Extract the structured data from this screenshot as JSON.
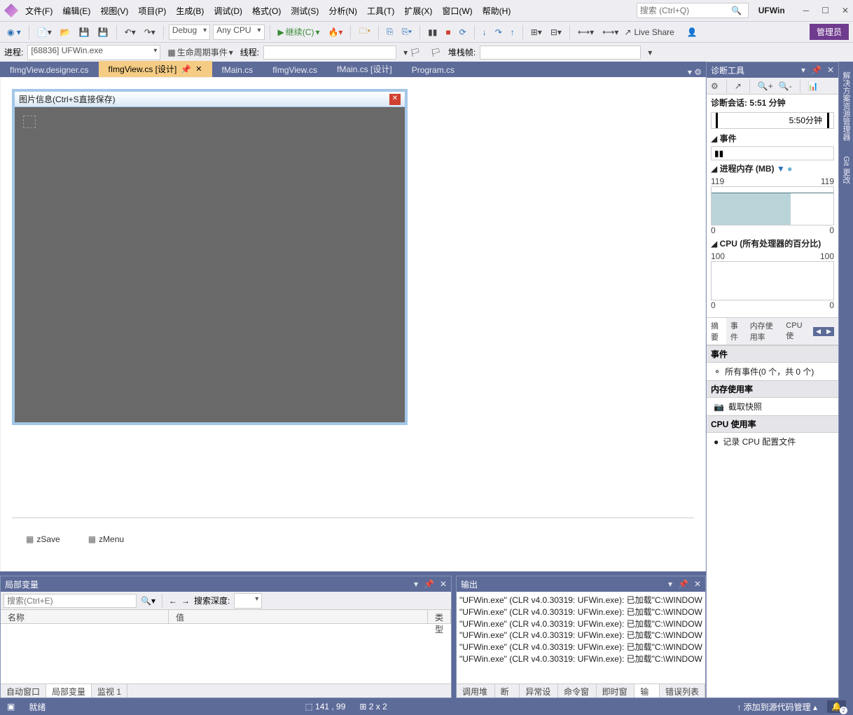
{
  "menu": {
    "file": "文件(F)",
    "edit": "编辑(E)",
    "view": "视图(V)",
    "project": "项目(P)",
    "build": "生成(B)",
    "debug": "调试(D)",
    "format": "格式(O)",
    "test": "测试(S)",
    "analyze": "分析(N)",
    "tools": "工具(T)",
    "extensions": "扩展(X)",
    "window": "窗口(W)",
    "help": "帮助(H)"
  },
  "search": {
    "placeholder": "搜索 (Ctrl+Q)"
  },
  "project_name": "UFWin",
  "toolbar": {
    "config": "Debug",
    "platform": "Any CPU",
    "start": "继续(C)",
    "liveshare": "Live Share",
    "admin": "管理员"
  },
  "toolbar2": {
    "process_lbl": "进程:",
    "process_val": "[68836] UFWin.exe",
    "lifecycle": "生命周期事件",
    "thread": "线程:",
    "stackframe": "堆栈帧:"
  },
  "tabs": {
    "t1": "fImgView.designer.cs",
    "t2": "fImgView.cs [设计]",
    "t3": "fMain.cs",
    "t4": "fImgView.cs",
    "t5": "fMain.cs [设计]",
    "t6": "Program.cs"
  },
  "form": {
    "title": "图片信息(Ctrl+S直接保存)"
  },
  "tray": {
    "i1": "zSave",
    "i2": "zMenu"
  },
  "locals": {
    "title": "局部变量",
    "search_ph": "搜索(Ctrl+E)",
    "depth": "搜索深度:",
    "col1": "名称",
    "col2": "值",
    "col3": "类型",
    "tab1": "自动窗口",
    "tab2": "局部变量",
    "tab3": "监视 1"
  },
  "output": {
    "title": "输出",
    "tab1": "调用堆栈",
    "tab2": "断点",
    "tab3": "异常设置",
    "tab4": "命令窗口",
    "tab5": "即时窗口",
    "tab6": "输出",
    "tab7": "错误列表 ...",
    "lines": [
      "\"UFWin.exe\" (CLR v4.0.30319: UFWin.exe): 已加载\"C:\\WINDOW",
      "\"UFWin.exe\" (CLR v4.0.30319: UFWin.exe): 已加载\"C:\\WINDOW",
      "\"UFWin.exe\" (CLR v4.0.30319: UFWin.exe): 已加载\"C:\\WINDOW",
      "\"UFWin.exe\" (CLR v4.0.30319: UFWin.exe): 已加载\"C:\\WINDOW",
      "\"UFWin.exe\" (CLR v4.0.30319: UFWin.exe): 已加载\"C:\\WINDOW",
      "\"UFWin.exe\" (CLR v4.0.30319: UFWin.exe): 已加载\"C:\\WINDOW"
    ]
  },
  "diag": {
    "title": "诊断工具",
    "session": "诊断会话: 5:51 分钟",
    "time_mark": "5:50分钟",
    "events_hdr": "事件",
    "mem_hdr": "进程内存 (MB)",
    "mem_max": "119",
    "mem_min": "0",
    "cpu_hdr": "CPU (所有处理器的百分比)",
    "cpu_max": "100",
    "cpu_min": "0",
    "tabs": {
      "t1": "摘要",
      "t2": "事件",
      "t3": "内存使用率",
      "t4": "CPU 使"
    },
    "sec_events": "事件",
    "sec_events_row": "所有事件(0 个，共 0 个)",
    "sec_mem": "内存使用率",
    "sec_mem_row": "截取快照",
    "sec_cpu": "CPU 使用率",
    "sec_cpu_row": "记录 CPU 配置文件"
  },
  "side": {
    "t1": "解决方案资源管理器",
    "t2": "Git 更改"
  },
  "status": {
    "ready": "就绪",
    "pos": "141 , 99",
    "size": "2 x 2",
    "scm": "添加到源代码管理"
  }
}
